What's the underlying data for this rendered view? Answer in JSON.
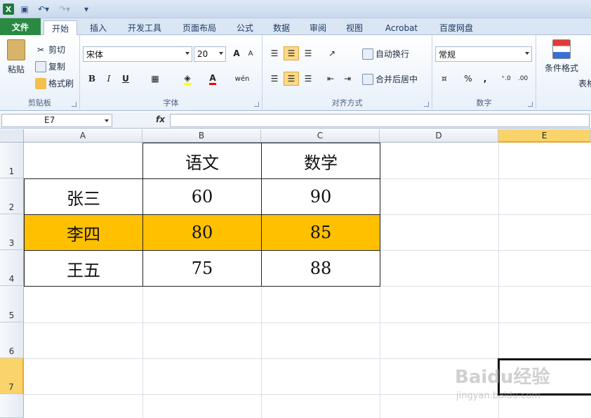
{
  "quick_access": {
    "logo": "X"
  },
  "tabs": [
    "文件",
    "开始",
    "插入",
    "开发工具",
    "页面布局",
    "公式",
    "数据",
    "审阅",
    "视图",
    "Acrobat",
    "百度网盘"
  ],
  "ribbon": {
    "clipboard": {
      "label": "剪贴板",
      "paste": "粘贴",
      "cut": "剪切",
      "copy": "复制",
      "format_painter": "格式刷"
    },
    "font": {
      "label": "字体",
      "name": "宋体",
      "size": "20",
      "bold": "B",
      "italic": "I",
      "underline": "U",
      "grow": "A",
      "shrink": "A",
      "phonetic": "wén"
    },
    "alignment": {
      "label": "对齐方式",
      "wrap": "自动换行",
      "merge": "合并后居中"
    },
    "number": {
      "label": "数字",
      "format": "常规",
      "percent": "%",
      "comma": ","
    },
    "styles": {
      "cond_format": "条件格式",
      "table": "表格"
    }
  },
  "formula_bar": {
    "name_box": "E7",
    "fx": "fx",
    "formula": ""
  },
  "sheet": {
    "columns": [
      "A",
      "B",
      "C",
      "D",
      "E"
    ],
    "rows": [
      "1",
      "2",
      "3",
      "4",
      "5",
      "6",
      "7"
    ],
    "header_row": [
      "",
      "语文",
      "数学"
    ],
    "data": [
      [
        "张三",
        "60",
        "90"
      ],
      [
        "李四",
        "80",
        "85"
      ],
      [
        "王五",
        "75",
        "88"
      ]
    ],
    "highlight_color": "#ffc000",
    "active_cell": "E7"
  },
  "watermark": {
    "main": "Baidu经验",
    "sub": "jingyan.baidu.com"
  }
}
